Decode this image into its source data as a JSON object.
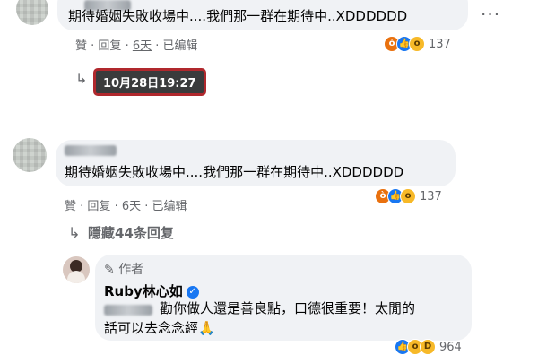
{
  "comment1": {
    "text": "期待婚姻失敗收場中....我們那一群在期待中..XDDDDDD",
    "like": "贊",
    "reply": "回复",
    "age": "6天",
    "edited": "已编辑",
    "reaction_count": "137",
    "timestamp": "10月28日19:27"
  },
  "comment2": {
    "name_suffix": "",
    "text": "期待婚姻失敗收場中....我們那一群在期待中..XDDDDDD",
    "like": "贊",
    "reply": "回复",
    "age": "6天",
    "edited": "已编辑",
    "reaction_count": "137",
    "hidden_replies": "隱藏44条回复"
  },
  "reply": {
    "author_tag": "作者",
    "name": "Ruby林心如",
    "text_line1": "勸你做人還是善良點，口德很重要！太閒的",
    "text_line2": "話可以去念念經",
    "reaction_count": "964"
  },
  "icons": {
    "more": "more-horizontal-icon",
    "reply_arrow": "reply-arrow-icon",
    "pen": "pen-icon",
    "verified": "verified-badge-icon",
    "pray": "pray-emoji-icon"
  },
  "colors": {
    "bubble": "#f0f2f5",
    "meta": "#65676b",
    "timestamp_border": "#b0282d",
    "verified": "#1877f2"
  }
}
